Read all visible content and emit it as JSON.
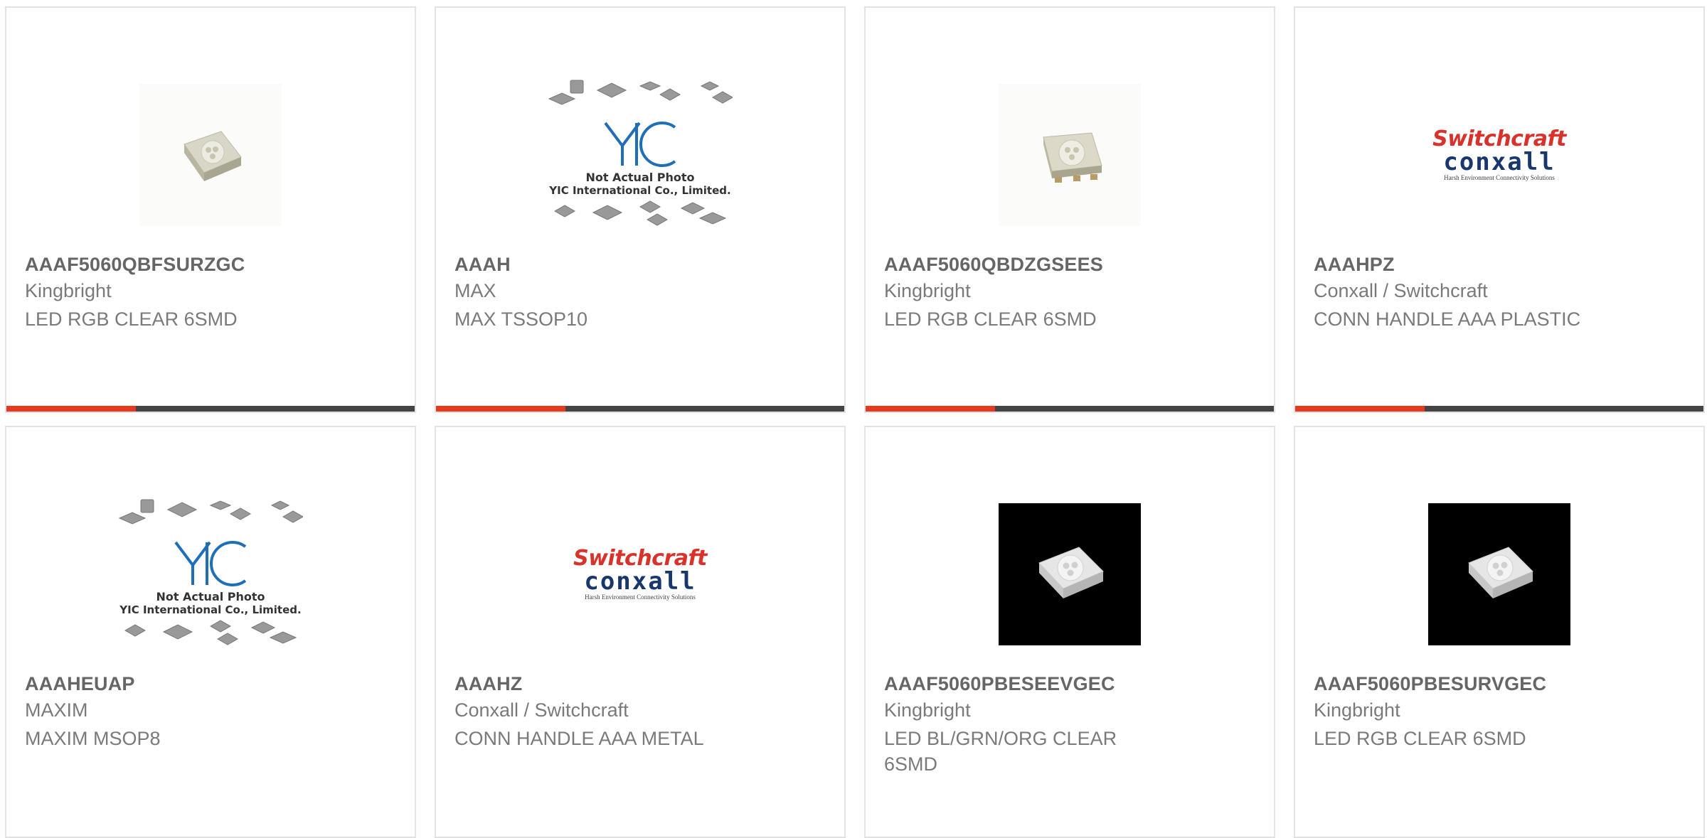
{
  "products": [
    {
      "part": "AAAF5060QBFSURZGC",
      "manufacturer": "Kingbright",
      "description": "LED RGB CLEAR 6SMD",
      "image": "led-smd-white"
    },
    {
      "part": "AAAH",
      "manufacturer": "MAX",
      "description": "MAX TSSOP10",
      "image": "yic-placeholder"
    },
    {
      "part": "AAAF5060QBDZGSEES",
      "manufacturer": "Kingbright",
      "description": "LED RGB CLEAR 6SMD",
      "image": "led-smd-white"
    },
    {
      "part": "AAAHPZ",
      "manufacturer": "Conxall / Switchcraft",
      "description": "CONN HANDLE AAA PLASTIC",
      "image": "switchcraft-logo"
    },
    {
      "part": "AAAHEUAP",
      "manufacturer": "MAXIM",
      "description": "MAXIM MSOP8",
      "image": "yic-placeholder"
    },
    {
      "part": "AAAHZ",
      "manufacturer": "Conxall / Switchcraft",
      "description": "CONN HANDLE AAA METAL",
      "image": "switchcraft-logo"
    },
    {
      "part": "AAAF5060PBESEEVGEC",
      "manufacturer": "Kingbright",
      "description": "LED BL/GRN/ORG CLEAR 6SMD",
      "image": "led-smd-dark"
    },
    {
      "part": "AAAF5060PBESURVGEC",
      "manufacturer": "Kingbright",
      "description": "LED RGB CLEAR 6SMD",
      "image": "led-smd-dark"
    }
  ],
  "placeholder": {
    "line1": "Not Actual Photo",
    "line2": "YIC International Co., Limited.",
    "logo_text": "YIC"
  },
  "switchcraft": {
    "brand1": "Switchcraft",
    "brand2": "conxall",
    "tagline": "Harsh Environment Connectivity Solutions"
  },
  "colors": {
    "accent": "#e8391d",
    "bar": "#444444",
    "border": "#e3e3e3",
    "switchcraft_red": "#d9322b",
    "conxall_blue": "#17376e",
    "yic_blue": "#1e6fb8"
  }
}
